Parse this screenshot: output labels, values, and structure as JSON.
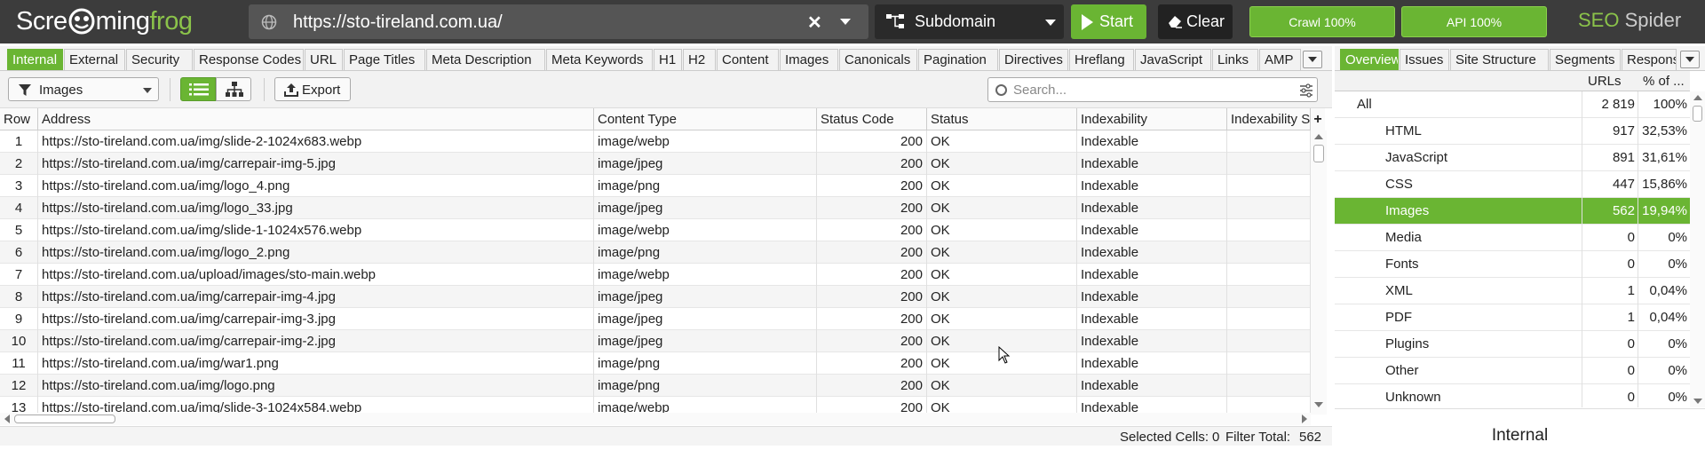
{
  "app": {
    "logo_part1": "Scre",
    "logo_part2": "ming",
    "logo_part3": "frog",
    "product_seo": "SEO",
    "product_spider": " Spider"
  },
  "topbar": {
    "url": "https://sto-tireland.com.ua/",
    "mode": "Subdomain",
    "start_label": "Start",
    "clear_label": "Clear",
    "crawl_progress": "Crawl 100%",
    "api_progress": "API 100%",
    "accent_color": "#6ab533"
  },
  "tabs": [
    "Internal",
    "External",
    "Security",
    "Response Codes",
    "URL",
    "Page Titles",
    "Meta Description",
    "Meta Keywords",
    "H1",
    "H2",
    "Content",
    "Images",
    "Canonicals",
    "Pagination",
    "Directives",
    "Hreflang",
    "JavaScript",
    "Links",
    "AMP"
  ],
  "right_tabs": [
    "Overview",
    "Issues",
    "Site Structure",
    "Segments",
    "Response Times"
  ],
  "toolbar": {
    "filter": "Images",
    "export_label": "Export",
    "search_placeholder": "Search..."
  },
  "grid": {
    "columns": [
      "Row",
      "Address",
      "Content Type",
      "Status Code",
      "Status",
      "Indexability",
      "Indexability Status"
    ],
    "rows": [
      [
        "1",
        "https://sto-tireland.com.ua/img/slide-2-1024x683.webp",
        "image/webp",
        "200",
        "OK",
        "Indexable"
      ],
      [
        "2",
        "https://sto-tireland.com.ua/img/carrepair-img-5.jpg",
        "image/jpeg",
        "200",
        "OK",
        "Indexable"
      ],
      [
        "3",
        "https://sto-tireland.com.ua/img/logo_4.png",
        "image/png",
        "200",
        "OK",
        "Indexable"
      ],
      [
        "4",
        "https://sto-tireland.com.ua/img/logo_33.jpg",
        "image/jpeg",
        "200",
        "OK",
        "Indexable"
      ],
      [
        "5",
        "https://sto-tireland.com.ua/img/slide-1-1024x576.webp",
        "image/webp",
        "200",
        "OK",
        "Indexable"
      ],
      [
        "6",
        "https://sto-tireland.com.ua/img/logo_2.png",
        "image/png",
        "200",
        "OK",
        "Indexable"
      ],
      [
        "7",
        "https://sto-tireland.com.ua/upload/images/sto-main.webp",
        "image/webp",
        "200",
        "OK",
        "Indexable"
      ],
      [
        "8",
        "https://sto-tireland.com.ua/img/carrepair-img-4.jpg",
        "image/jpeg",
        "200",
        "OK",
        "Indexable"
      ],
      [
        "9",
        "https://sto-tireland.com.ua/img/carrepair-img-3.jpg",
        "image/jpeg",
        "200",
        "OK",
        "Indexable"
      ],
      [
        "10",
        "https://sto-tireland.com.ua/img/carrepair-img-2.jpg",
        "image/jpeg",
        "200",
        "OK",
        "Indexable"
      ],
      [
        "11",
        "https://sto-tireland.com.ua/img/war1.png",
        "image/png",
        "200",
        "OK",
        "Indexable"
      ],
      [
        "12",
        "https://sto-tireland.com.ua/img/logo.png",
        "image/png",
        "200",
        "OK",
        "Indexable"
      ],
      [
        "13",
        "https://sto-tireland.com.ua/img/slide-3-1024x584.webp",
        "image/webp",
        "200",
        "OK",
        "Indexable"
      ]
    ]
  },
  "status": {
    "selected_label": "Selected Cells:",
    "selected_value": "0",
    "filter_label": "Filter Total:",
    "filter_value": "562"
  },
  "overview": {
    "col_urls": "URLs",
    "col_pct": "% of ...",
    "rows": [
      [
        "All",
        "2 819",
        "100%"
      ],
      [
        "HTML",
        "917",
        "32,53%"
      ],
      [
        "JavaScript",
        "891",
        "31,61%"
      ],
      [
        "CSS",
        "447",
        "15,86%"
      ],
      [
        "Images",
        "562",
        "19,94%"
      ],
      [
        "Media",
        "0",
        "0%"
      ],
      [
        "Fonts",
        "0",
        "0%"
      ],
      [
        "XML",
        "1",
        "0,04%"
      ],
      [
        "PDF",
        "1",
        "0,04%"
      ],
      [
        "Plugins",
        "0",
        "0%"
      ],
      [
        "Other",
        "0",
        "0%"
      ],
      [
        "Unknown",
        "0",
        "0%"
      ]
    ],
    "selected_row": "Images",
    "footer": "Internal"
  }
}
